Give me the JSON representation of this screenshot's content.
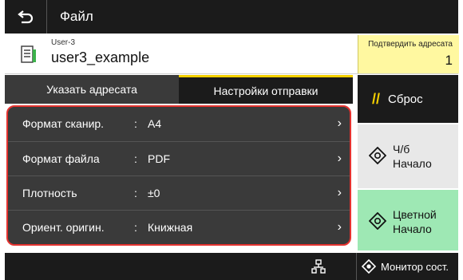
{
  "titlebar": {
    "title": "Файл",
    "back_icon": "back-arrow-icon"
  },
  "destination": {
    "user_small": "User-3",
    "user_name": "user3_example",
    "icon": "document-icon"
  },
  "confirm": {
    "label": "Подтвердить адресата",
    "count": "1"
  },
  "tabs": [
    {
      "label": "Указать адресата",
      "active": false
    },
    {
      "label": "Настройки отправки",
      "active": true
    }
  ],
  "settings": [
    {
      "label": "Формат сканир.",
      "colon": ":",
      "value": "A4"
    },
    {
      "label": "Формат файла",
      "colon": ":",
      "value": "PDF"
    },
    {
      "label": "Плотность",
      "colon": ":",
      "value": "±0"
    },
    {
      "label": "Ориент. оригин.",
      "colon": ":",
      "value": "Книжная"
    }
  ],
  "buttons": {
    "reset": "Сброс",
    "bw_start_line1": "Ч/б",
    "bw_start_line2": "Начало",
    "color_start_line1": "Цветной",
    "color_start_line2": "Начало"
  },
  "footer": {
    "monitor_label": "Монитор сост."
  },
  "colors": {
    "accent_yellow": "#f5d000",
    "highlight_red": "#e4322f",
    "color_start_green": "#9ee8b4"
  }
}
